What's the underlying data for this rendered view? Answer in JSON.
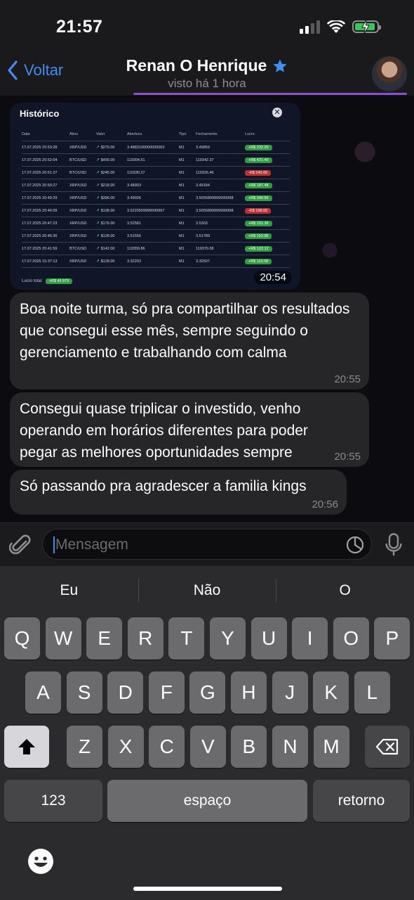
{
  "status_bar": {
    "time": "21:57"
  },
  "header": {
    "back_label": "Voltar",
    "contact_name": "Renan O Henrique",
    "last_seen": "visto há 1 hora",
    "star_color": "#3e8ef7"
  },
  "image_message": {
    "title": "Histórico",
    "columns": [
      "Data",
      "Ativo",
      "Valor",
      "Abertura",
      "Tipo",
      "Fechamento",
      "Lucro"
    ],
    "rows": [
      [
        "17.07.2025 20:53:28",
        "XRP/USD",
        "$270.00",
        "3.4883100000000002",
        "M1",
        "3.49859",
        "+R$ 232.20",
        "green"
      ],
      [
        "17.07.2025 20:52:04",
        "BTC/USD",
        "$490.00",
        "119304.51",
        "M1",
        "119342.37",
        "+R$ 421.40",
        "green"
      ],
      [
        "17.07.2025 20:51:27",
        "BTC/USD",
        "$245.00",
        "119330.27",
        "M1",
        "119326.46",
        "-R$ 245.00",
        "red"
      ],
      [
        "17.07.2025 20:50:27",
        "XRP/USD",
        "$218.00",
        "3.48903",
        "M1",
        "3.49184",
        "+R$ 187.48",
        "green"
      ],
      [
        "17.07.2025 20:49:29",
        "XRP/USD",
        "$396.00",
        "3.49926",
        "M1",
        "3.5055899999999998",
        "+R$ 340.56",
        "green"
      ],
      [
        "17.07.2025 20:49:09",
        "XRP/USD",
        "$198.00",
        "3.5220599999999997",
        "M1",
        "3.5055899999999998",
        "-R$ 198.00",
        "red"
      ],
      [
        "17.07.2025 20:47:23",
        "XRP/USD",
        "$176.00",
        "3.52581",
        "M1",
        "3.5303",
        "+R$ 151.36",
        "green"
      ],
      [
        "17.07.2025 20:45:30",
        "XRP/USD",
        "$128.00",
        "3.51556",
        "M1",
        "3.51789",
        "+R$ 110.08",
        "green"
      ],
      [
        "17.07.2025 20:41:59",
        "BTC/USD",
        "$142.00",
        "119359.86",
        "M1",
        "119370.08",
        "+R$ 122.12",
        "green"
      ],
      [
        "17.07.2025 15:37:13",
        "XRP/USD",
        "$128.00",
        "3.32203",
        "M1",
        "3.32507",
        "+R$ 110.08",
        "green"
      ]
    ],
    "total_label": "Lucro total:",
    "total_value": "+R$ 49 879",
    "time": "20:54"
  },
  "messages": [
    {
      "text": "Boa noite turma, só pra compartilhar os resultados que consegui esse mês, sempre seguindo o gerenciamento e trabalhando com calma",
      "time": "20:55"
    },
    {
      "text": "Consegui quase triplicar o investido, venho operando em horários diferentes para poder pegar as melhores oportunidades sempre",
      "time": "20:55"
    },
    {
      "text": "Só passando pra agradescer a familia kings",
      "time": "20:56"
    }
  ],
  "input": {
    "placeholder": "Mensagem"
  },
  "keyboard": {
    "suggestions": [
      "Eu",
      "Não",
      "O"
    ],
    "row1": [
      "Q",
      "W",
      "E",
      "R",
      "T",
      "Y",
      "U",
      "I",
      "O",
      "P"
    ],
    "row2": [
      "A",
      "S",
      "D",
      "F",
      "G",
      "H",
      "J",
      "K",
      "L"
    ],
    "row3": [
      "Z",
      "X",
      "C",
      "V",
      "B",
      "N",
      "M"
    ],
    "numbers_label": "123",
    "space_label": "espaço",
    "return_label": "retorno"
  }
}
